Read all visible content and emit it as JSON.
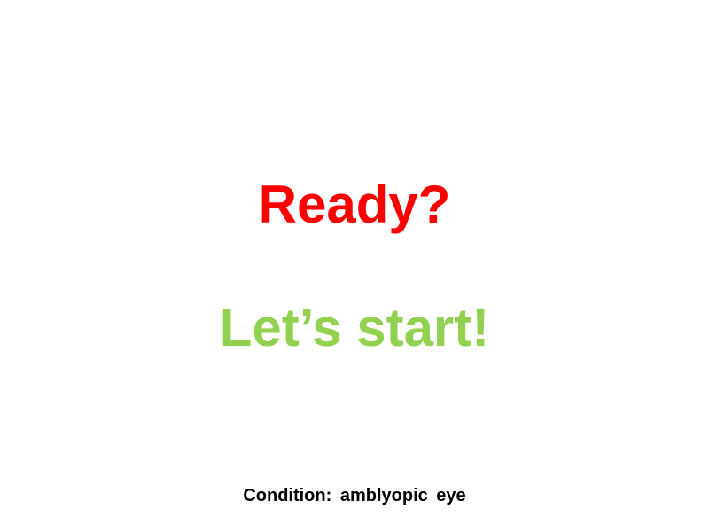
{
  "screen": {
    "ready_text": "Ready?",
    "start_text": "Let’s start!",
    "condition_text": "Condition:  amblyopic eye"
  },
  "colors": {
    "background": "#ffffff",
    "ready": "#ff0000",
    "start": "#92d050",
    "condition": "#000000"
  }
}
